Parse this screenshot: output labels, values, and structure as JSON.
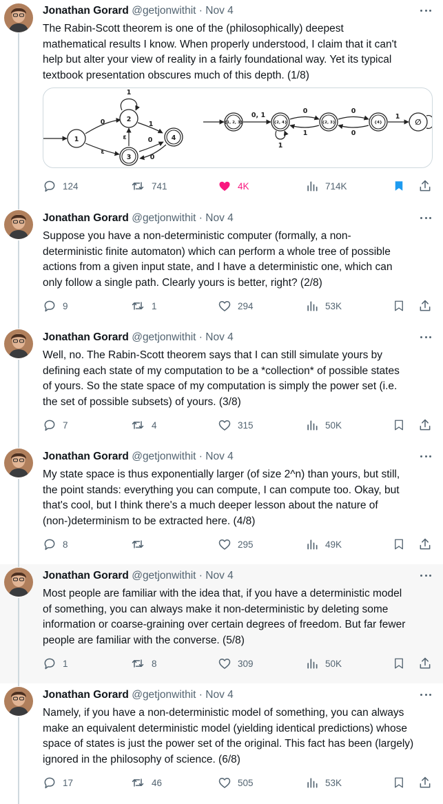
{
  "author": {
    "name": "Jonathan Gorard",
    "handle": "@getjonwithit",
    "date": "Nov 4"
  },
  "tweets": [
    {
      "text": "The Rabin-Scott theorem is one of the (philosophically) deepest\nmathematical results I know. When properly understood, I claim that it can't\nhelp but alter your view of reality in a fairly foundational way. Yet its typical\ntextbook presentation obscures much of this depth. (1/8)",
      "replies": "124",
      "retweets": "741",
      "likes": "4K",
      "views": "714K",
      "liked": true,
      "bookmarked": true
    },
    {
      "text": "Suppose you have a non-deterministic computer (formally, a non-\ndeterministic finite automaton) which can perform a whole tree of possible\nactions from a given input state, and I have a deterministic one, which can\nonly follow a single path. Clearly yours is better, right? (2/8)",
      "replies": "9",
      "retweets": "1",
      "likes": "294",
      "views": "53K",
      "liked": false,
      "bookmarked": false
    },
    {
      "text": "Well, no. The Rabin-Scott theorem says that I can still simulate yours by\ndefining each state of my computation to be a *collection* of possible states\nof yours. So the state space of my computation is simply the power set (i.e.\nthe set of possible subsets) of yours. (3/8)",
      "replies": "7",
      "retweets": "4",
      "likes": "315",
      "views": "50K",
      "liked": false,
      "bookmarked": false
    },
    {
      "text": "My state space is thus exponentially larger (of size 2^n) than yours, but still,\nthe point stands: everything you can compute, I can compute too. Okay, but\nthat's cool, but I think there's a much deeper lesson about the nature of\n(non-)determinism to be extracted here. (4/8)",
      "replies": "8",
      "retweets": "",
      "likes": "295",
      "views": "49K",
      "liked": false,
      "bookmarked": false
    },
    {
      "text": "Most people are familiar with the idea that, if you have a deterministic model\nof something, you can always make it non-deterministic by deleting some\ninformation or coarse-graining over certain degrees of freedom. But far fewer\npeople are familiar with the converse. (5/8)",
      "replies": "1",
      "retweets": "8",
      "likes": "309",
      "views": "50K",
      "liked": false,
      "bookmarked": false
    },
    {
      "text": "Namely, if you have a non-deterministic model of something, you can always\nmake an equivalent deterministic model (yielding identical predictions) whose\nspace of states is just the power set of the original. This fact has been (largely)\nignored in the philosophy of science. (6/8)",
      "replies": "17",
      "retweets": "46",
      "likes": "505",
      "views": "53K",
      "liked": false,
      "bookmarked": false
    }
  ],
  "diagram": {
    "nfa": {
      "states": [
        "1",
        "2",
        "3",
        "4"
      ],
      "edge_labels": [
        "0",
        "1",
        "1",
        "ε",
        "ε",
        "0",
        "0"
      ]
    },
    "dfa": {
      "states": [
        "{1, 2, 3}",
        "{2, 4}",
        "{2, 3}",
        "{4}",
        "∅"
      ],
      "edge_labels": [
        "0, 1",
        "0",
        "1",
        "0",
        "0",
        "1",
        "1"
      ]
    }
  },
  "colors": {
    "text": "#0f1419",
    "muted": "#536471",
    "like_pink": "#f91880",
    "bookmark_blue": "#1d9bf0",
    "border": "#cfd9de",
    "highlight_bg": "#f7f7f7"
  },
  "icons": [
    "reply-icon",
    "retweet-icon",
    "like-icon",
    "views-icon",
    "bookmark-icon",
    "share-icon",
    "more-icon"
  ]
}
